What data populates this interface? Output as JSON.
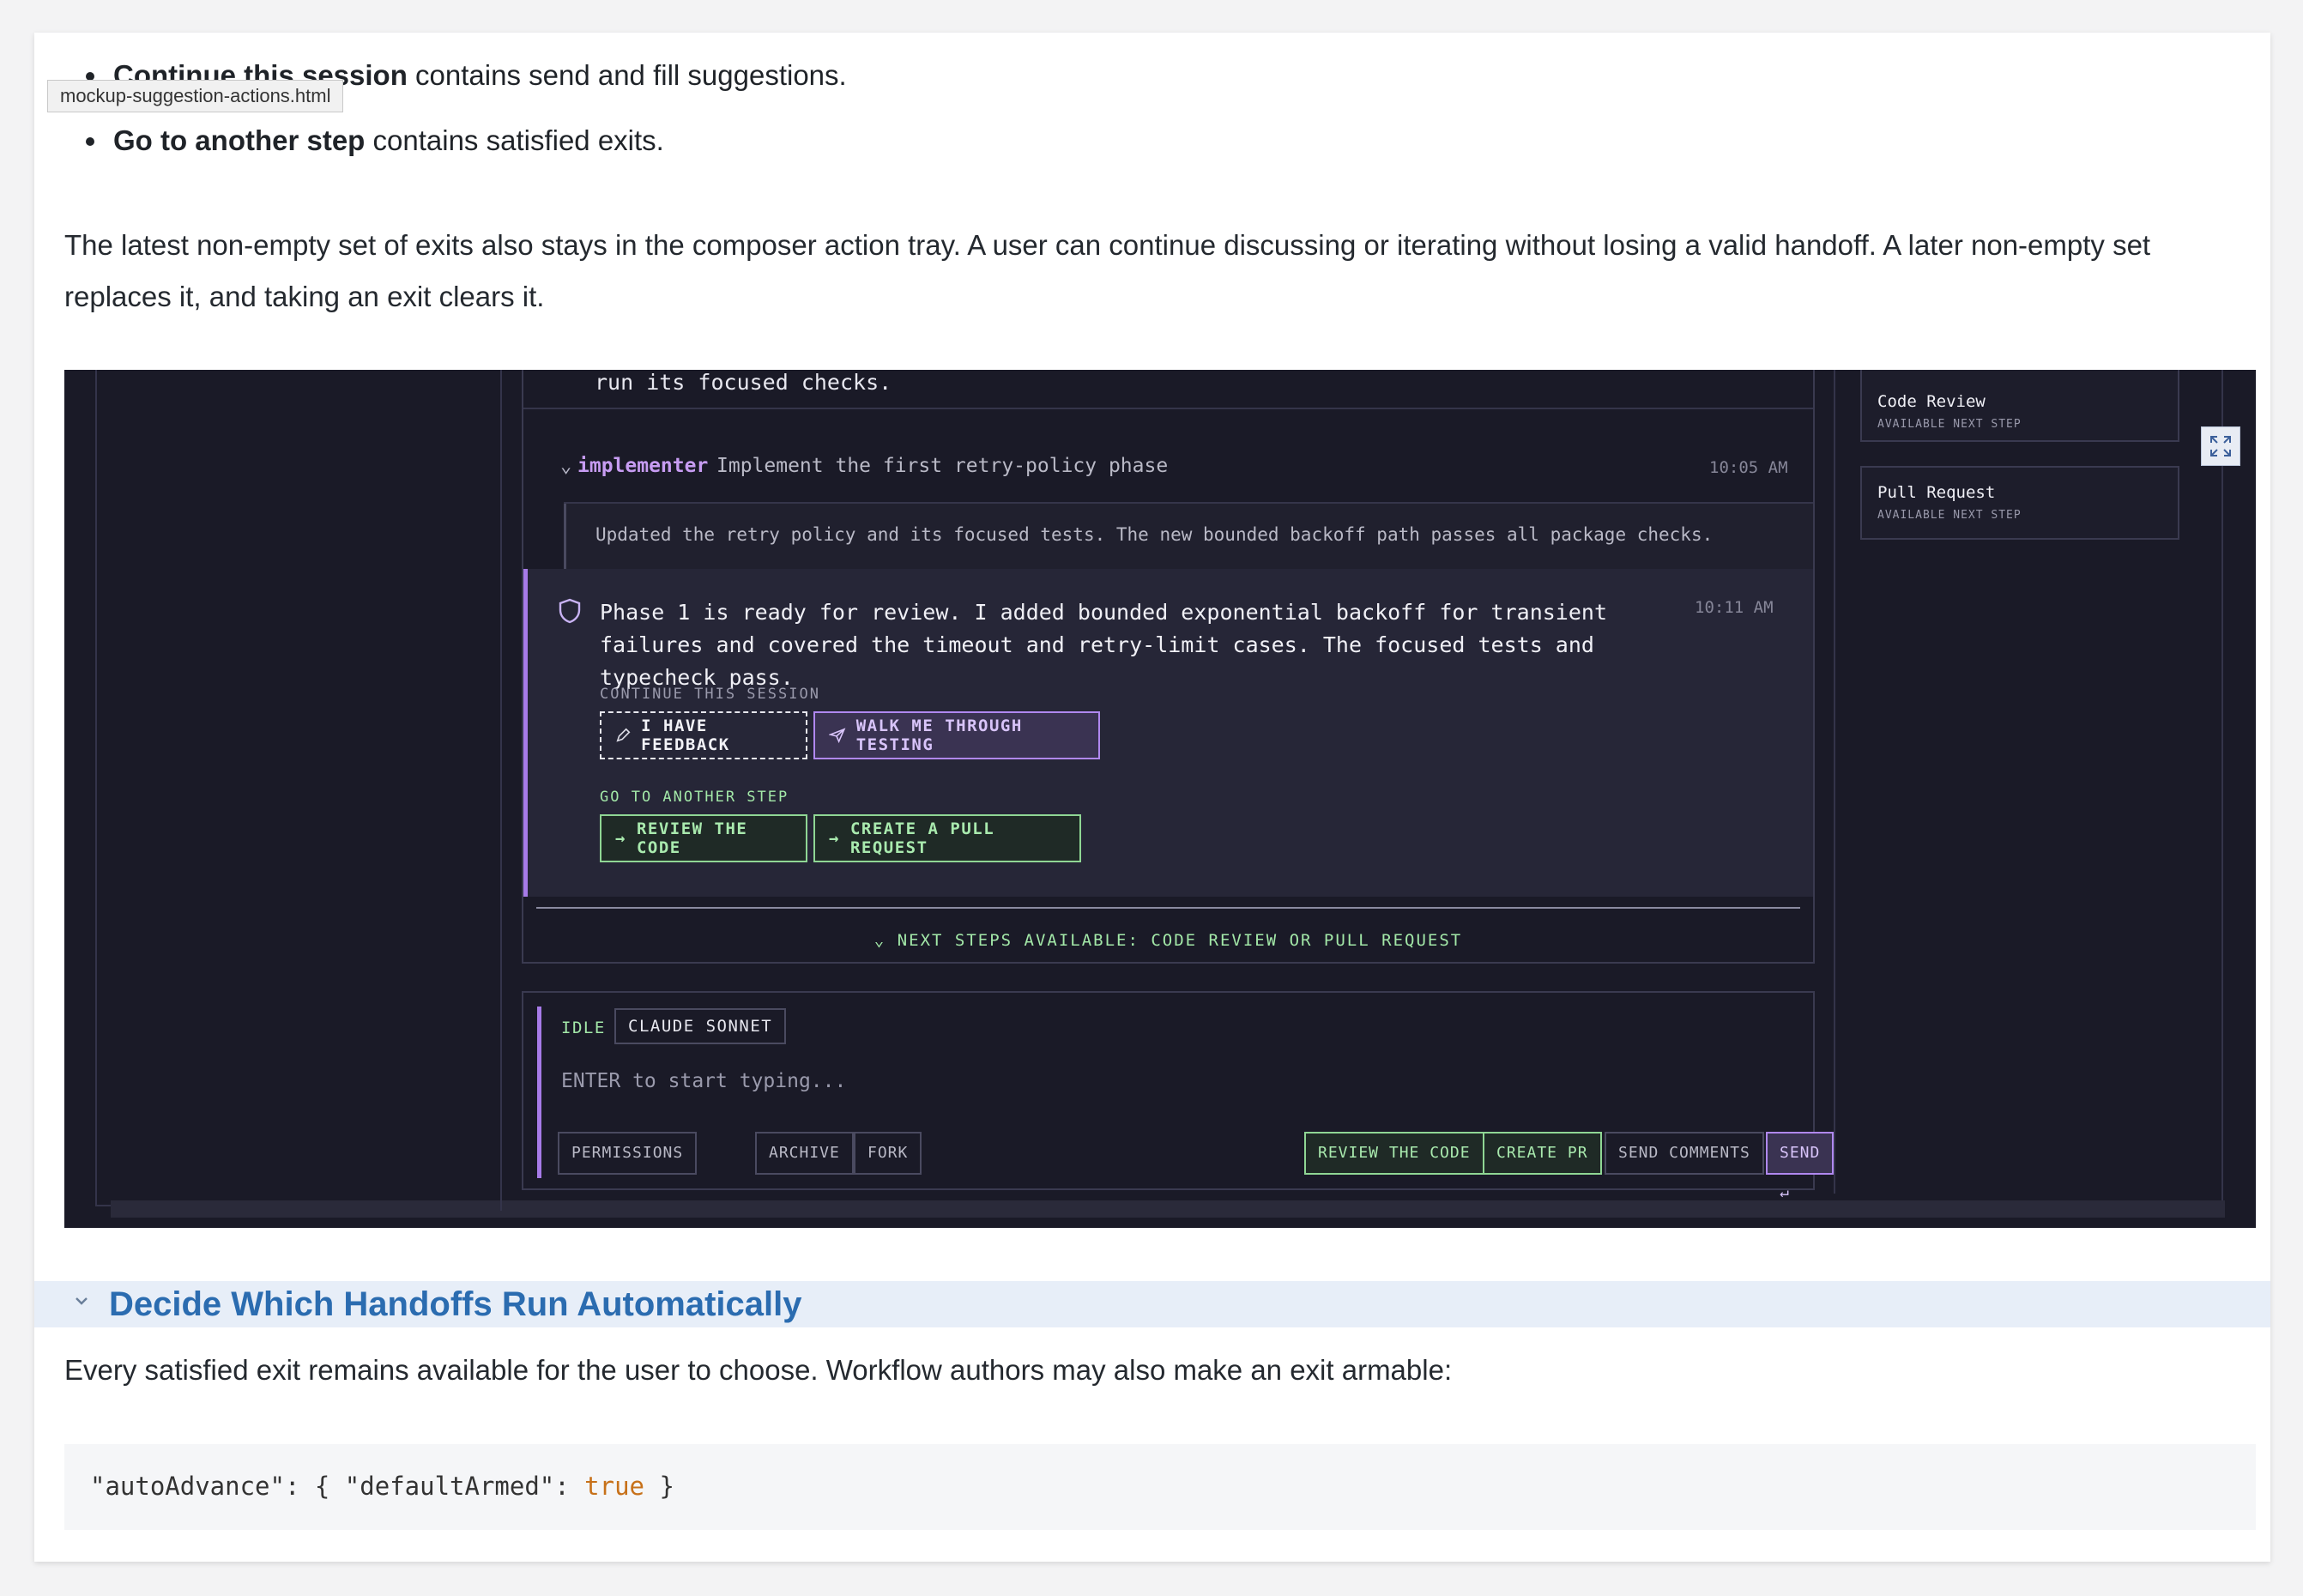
{
  "doc": {
    "bullets": [
      {
        "bold": "Continue this session",
        "rest": " contains send and fill suggestions."
      },
      {
        "bold": "Go to another step",
        "rest": " contains satisfied exits."
      }
    ],
    "tooltip": "mockup-suggestion-actions.html",
    "paragraph": "The latest non-empty set of exits also stays in the composer action tray. A user can continue discussing or iterating without losing a valid handoff. A later non-empty set replaces it, and taking an exit clears it.",
    "section_heading": "Decide Which Handoffs Run Automatically",
    "section_paragraph": "Every satisfied exit remains available for the user to choose. Workflow authors may also make an exit armable:",
    "code": {
      "prefix": "\"autoAdvance\": { \"defaultArmed\": ",
      "keyword": "true",
      "suffix": " }"
    }
  },
  "mock": {
    "top_line": "run its focused checks.",
    "impl_name": "implementer",
    "impl_desc": "Implement the first retry-policy phase",
    "impl_time": "10:05 AM",
    "impl_quote": "Updated the retry policy and its focused tests. The new bounded backoff path passes all package checks.",
    "msg_text": "Phase 1 is ready for review. I added bounded exponential backoff for transient failures and covered the timeout and retry-limit cases. The focused tests and typecheck pass.",
    "msg_time": "10:11 AM",
    "continue_label": "CONTINUE THIS SESSION",
    "btn_feedback": "I HAVE FEEDBACK",
    "btn_walk": "WALK ME THROUGH TESTING",
    "goto_label": "GO TO ANOTHER STEP",
    "btn_review": "REVIEW THE CODE",
    "btn_pr": "CREATE A PULL REQUEST",
    "next_steps": "NEXT STEPS AVAILABLE: CODE REVIEW OR PULL REQUEST",
    "composer": {
      "status": "IDLE",
      "model": "CLAUDE SONNET",
      "placeholder": "ENTER to start typing...",
      "permissions": "PERMISSIONS",
      "archive": "ARCHIVE",
      "fork": "FORK",
      "review": "REVIEW THE CODE",
      "create_pr": "CREATE PR",
      "send_comments": "SEND COMMENTS",
      "send": "SEND ↵"
    },
    "side": [
      {
        "title": "Code Review",
        "sub": "AVAILABLE NEXT STEP"
      },
      {
        "title": "Pull Request",
        "sub": "AVAILABLE NEXT STEP"
      }
    ],
    "colors": {
      "accent_purple": "#a77be8",
      "accent_green": "#8fd694",
      "bg": "#1a1a27"
    }
  }
}
